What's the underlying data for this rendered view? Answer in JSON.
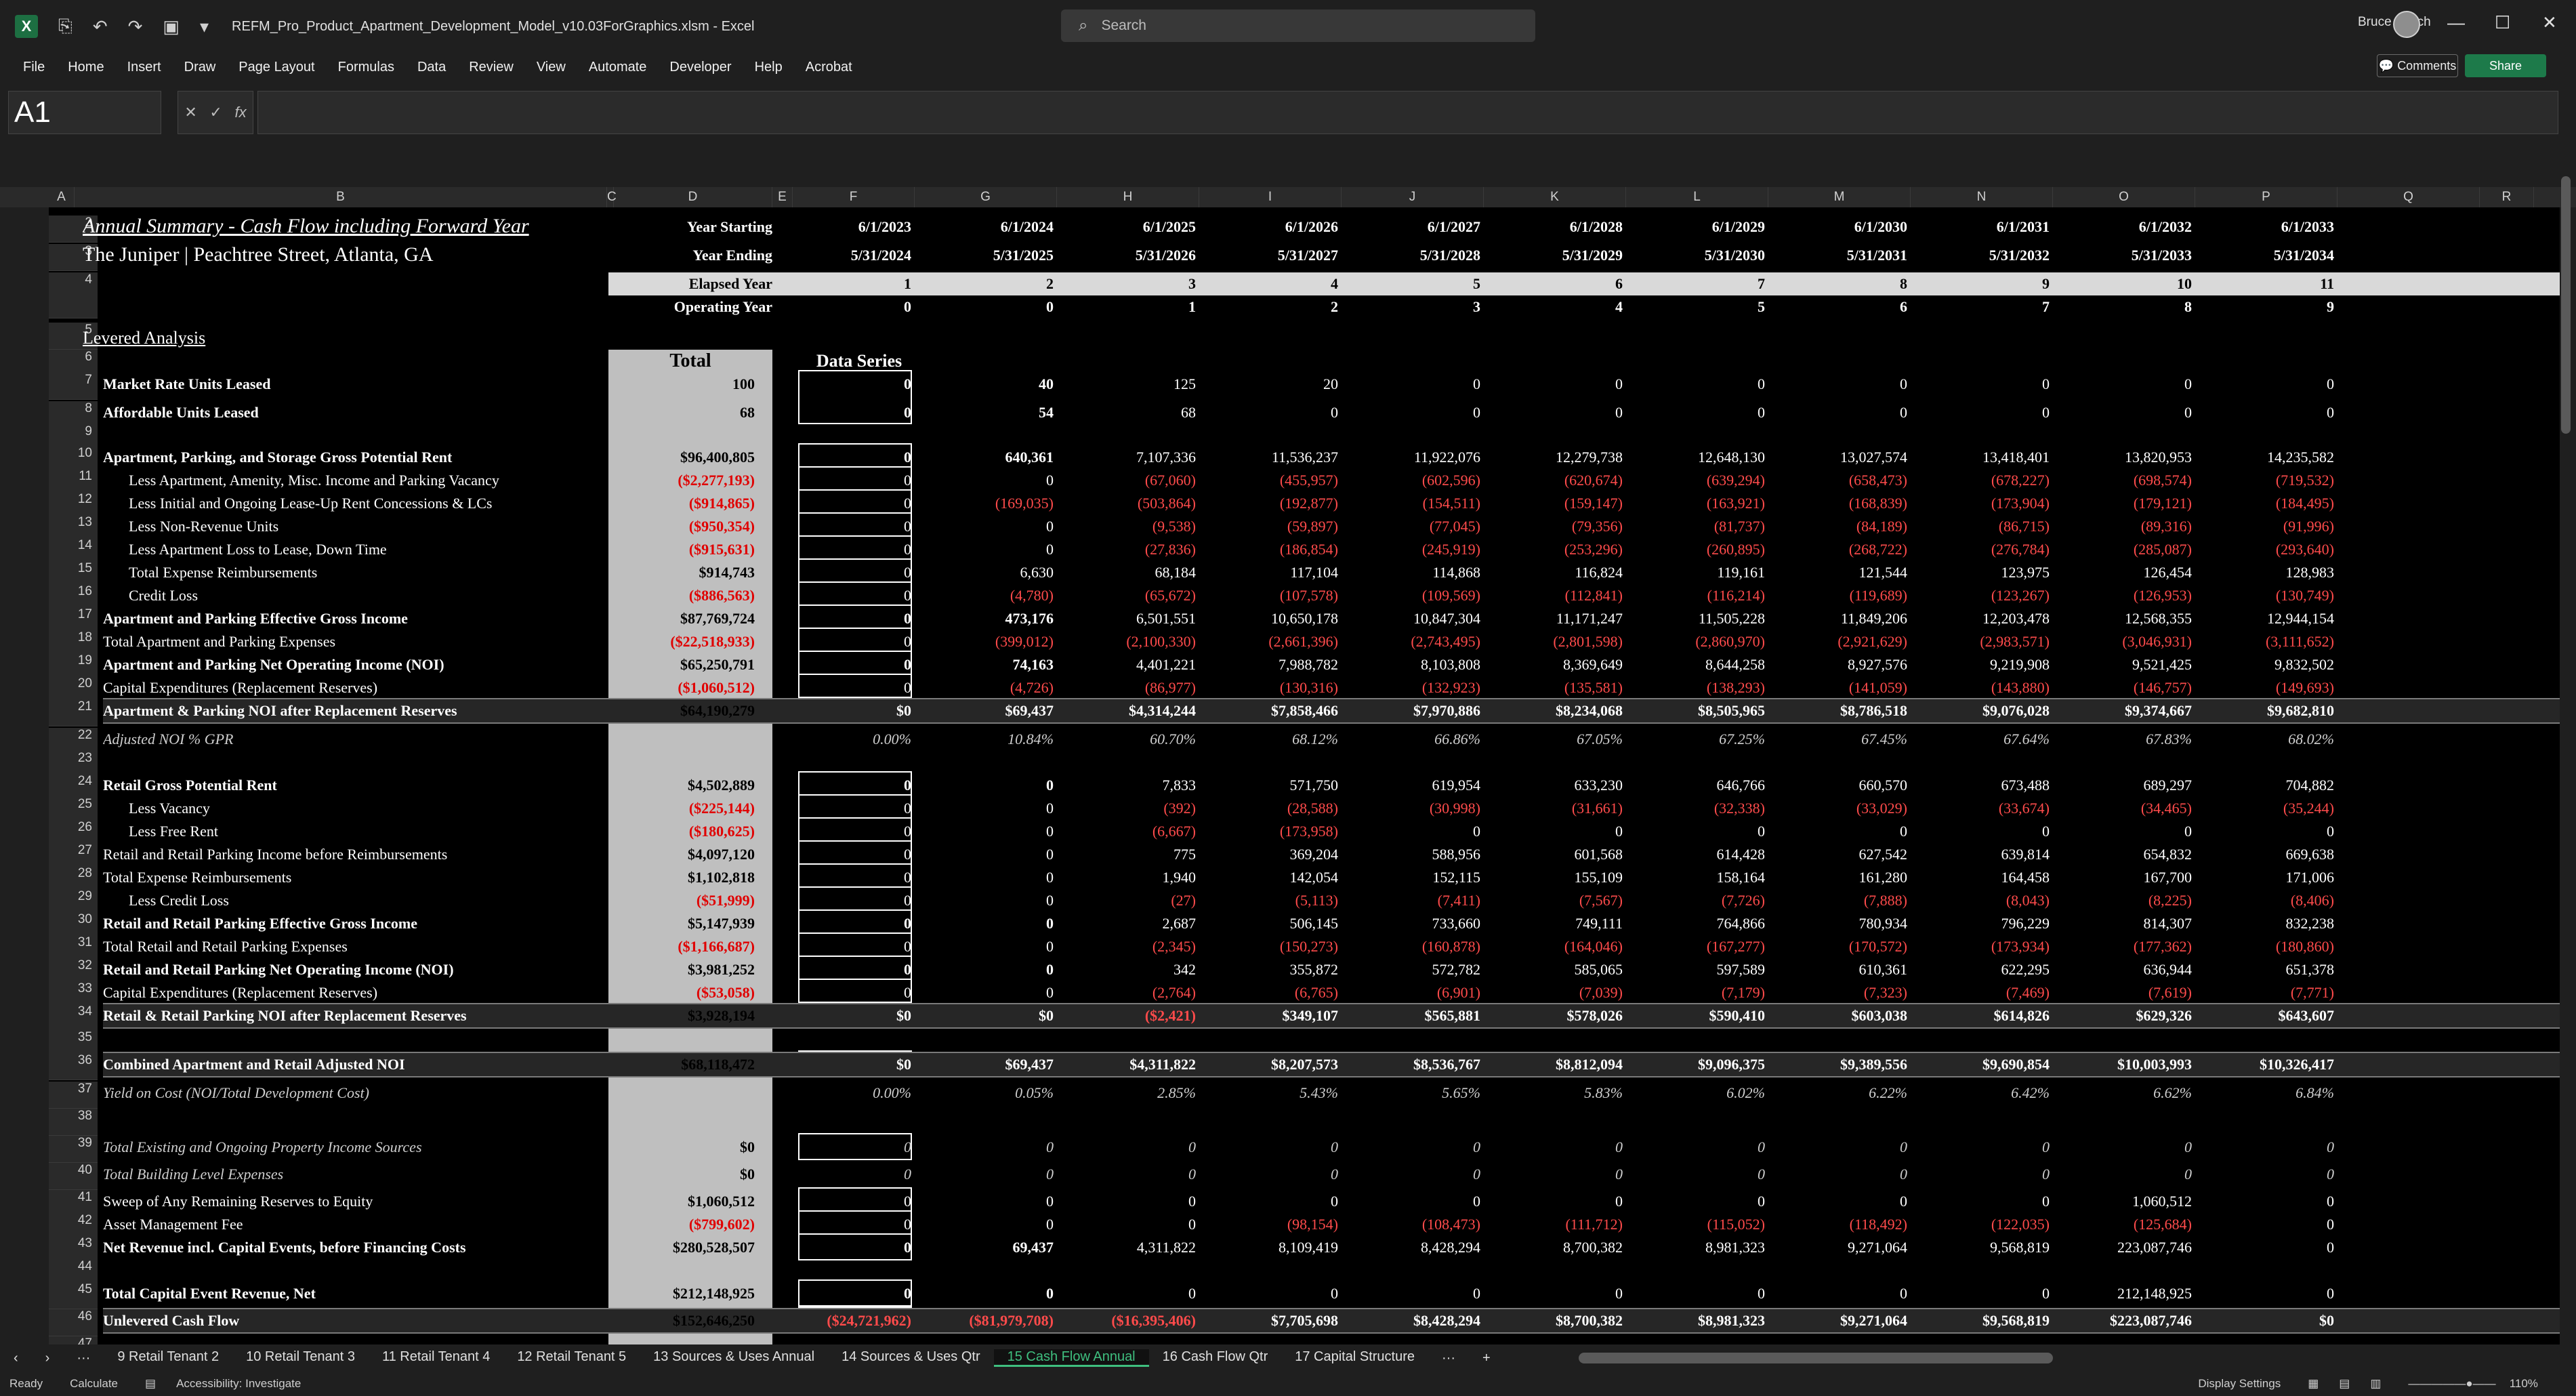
{
  "window": {
    "title": "REFM_Pro_Product_Apartment_Development_Model_v10.03ForGraphics.xlsm  -  Excel",
    "search_placeholder": "Search",
    "user": "Bruce Kirsch"
  },
  "menu": [
    "File",
    "Home",
    "Insert",
    "Draw",
    "Page Layout",
    "Formulas",
    "Data",
    "Review",
    "View",
    "Automate",
    "Developer",
    "Help",
    "Acrobat"
  ],
  "buttons": {
    "comments": "Comments",
    "share": "Share"
  },
  "formula": {
    "namebox": "A1",
    "fx": "fx"
  },
  "columns": [
    "A",
    "B",
    "C",
    "D",
    "E",
    "F",
    "G",
    "H",
    "I",
    "J",
    "K",
    "L",
    "M",
    "N",
    "O",
    "P",
    "Q",
    "R"
  ],
  "sheet": {
    "title": "Annual Summary - Cash Flow including Forward Year",
    "subtitle": "The Juniper  |  Peachtree Street, Atlanta, GA",
    "section": "Levered Analysis",
    "total_header": "Total",
    "series_header": "Data Series",
    "year_labels": [
      "Year Starting",
      "Year Ending",
      "Elapsed Year",
      "Operating Year"
    ],
    "year_starting": [
      "6/1/2023",
      "6/1/2024",
      "6/1/2025",
      "6/1/2026",
      "6/1/2027",
      "6/1/2028",
      "6/1/2029",
      "6/1/2030",
      "6/1/2031",
      "6/1/2032",
      "6/1/2033"
    ],
    "year_ending": [
      "5/31/2024",
      "5/31/2025",
      "5/31/2026",
      "5/31/2027",
      "5/31/2028",
      "5/31/2029",
      "5/31/2030",
      "5/31/2031",
      "5/31/2032",
      "5/31/2033",
      "5/31/2034"
    ],
    "elapsed": [
      "1",
      "2",
      "3",
      "4",
      "5",
      "6",
      "7",
      "8",
      "9",
      "10",
      "11"
    ],
    "operating": [
      "0",
      "0",
      "1",
      "2",
      "3",
      "4",
      "5",
      "6",
      "7",
      "8",
      "9"
    ],
    "rows": [
      {
        "r": "7",
        "label": "Market Rate Units Leased",
        "style": "b",
        "total": "100",
        "vals": [
          "0",
          "40",
          "125",
          "20",
          "0",
          "0",
          "0",
          "0",
          "0",
          "0",
          "0"
        ]
      },
      {
        "r": "8",
        "label": "Affordable Units Leased",
        "style": "b",
        "total": "68",
        "vals": [
          "0",
          "54",
          "68",
          "0",
          "0",
          "0",
          "0",
          "0",
          "0",
          "0",
          "0"
        ]
      },
      {
        "r": "10",
        "label": "Apartment, Parking, and Storage Gross Potential Rent",
        "style": "b",
        "total": "$96,400,805",
        "vals": [
          "0",
          "640,361",
          "7,107,336",
          "11,536,237",
          "11,922,076",
          "12,279,738",
          "12,648,130",
          "13,027,574",
          "13,418,401",
          "13,820,953",
          "14,235,582"
        ]
      },
      {
        "r": "11",
        "label": "Less Apartment, Amenity, Misc. Income and Parking Vacancy",
        "style": "ind",
        "total": "($2,277,193)",
        "vals": [
          "0",
          "0",
          "(67,060)",
          "(455,957)",
          "(602,596)",
          "(620,674)",
          "(639,294)",
          "(658,473)",
          "(678,227)",
          "(698,574)",
          "(719,532)"
        ]
      },
      {
        "r": "12",
        "label": "Less Initial and Ongoing Lease-Up Rent Concessions & LCs",
        "style": "ind",
        "total": "($914,865)",
        "vals": [
          "0",
          "(169,035)",
          "(503,864)",
          "(192,877)",
          "(154,511)",
          "(159,147)",
          "(163,921)",
          "(168,839)",
          "(173,904)",
          "(179,121)",
          "(184,495)"
        ]
      },
      {
        "r": "13",
        "label": "Less Non-Revenue Units",
        "style": "ind",
        "total": "($950,354)",
        "vals": [
          "0",
          "0",
          "(9,538)",
          "(59,897)",
          "(77,045)",
          "(79,356)",
          "(81,737)",
          "(84,189)",
          "(86,715)",
          "(89,316)",
          "(91,996)"
        ]
      },
      {
        "r": "14",
        "label": "Less Apartment Loss to Lease, Down Time",
        "style": "ind",
        "total": "($915,631)",
        "vals": [
          "0",
          "0",
          "(27,836)",
          "(186,854)",
          "(245,919)",
          "(253,296)",
          "(260,895)",
          "(268,722)",
          "(276,784)",
          "(285,087)",
          "(293,640)"
        ]
      },
      {
        "r": "15",
        "label": "Total Expense Reimbursements",
        "style": "ind",
        "total": "$914,743",
        "vals": [
          "0",
          "6,630",
          "68,184",
          "117,104",
          "114,868",
          "116,824",
          "119,161",
          "121,544",
          "123,975",
          "126,454",
          "128,983"
        ]
      },
      {
        "r": "16",
        "label": "Credit Loss",
        "style": "ind",
        "total": "($886,563)",
        "vals": [
          "0",
          "(4,780)",
          "(65,672)",
          "(107,578)",
          "(109,569)",
          "(112,841)",
          "(116,214)",
          "(119,689)",
          "(123,267)",
          "(126,953)",
          "(130,749)"
        ]
      },
      {
        "r": "17",
        "label": "Apartment and Parking Effective Gross Income",
        "style": "b",
        "total": "$87,769,724",
        "vals": [
          "0",
          "473,176",
          "6,501,551",
          "10,650,178",
          "10,847,304",
          "11,171,247",
          "11,505,228",
          "11,849,206",
          "12,203,478",
          "12,568,355",
          "12,944,154"
        ]
      },
      {
        "r": "18",
        "label": "Total Apartment and Parking Expenses",
        "style": "",
        "total": "($22,518,933)",
        "vals": [
          "0",
          "(399,012)",
          "(2,100,330)",
          "(2,661,396)",
          "(2,743,495)",
          "(2,801,598)",
          "(2,860,970)",
          "(2,921,629)",
          "(2,983,571)",
          "(3,046,931)",
          "(3,111,652)"
        ]
      },
      {
        "r": "19",
        "label": "Apartment and Parking Net Operating Income (NOI)",
        "style": "b",
        "total": "$65,250,791",
        "vals": [
          "0",
          "74,163",
          "4,401,221",
          "7,988,782",
          "8,103,808",
          "8,369,649",
          "8,644,258",
          "8,927,576",
          "9,219,908",
          "9,521,425",
          "9,832,502"
        ]
      },
      {
        "r": "20",
        "label": "Capital Expenditures (Replacement Reserves)",
        "style": "",
        "total": "($1,060,512)",
        "vals": [
          "0",
          "(4,726)",
          "(86,977)",
          "(130,316)",
          "(132,923)",
          "(135,581)",
          "(138,293)",
          "(141,059)",
          "(143,880)",
          "(146,757)",
          "(149,693)"
        ]
      },
      {
        "r": "21",
        "label": "Apartment & Parking NOI after Replacement Reserves",
        "style": "hl",
        "total": "$64,190,279",
        "vals": [
          "$0",
          "$69,437",
          "$4,314,244",
          "$7,858,466",
          "$7,970,886",
          "$8,234,068",
          "$8,505,965",
          "$8,786,518",
          "$9,076,028",
          "$9,374,667",
          "$9,682,810"
        ]
      },
      {
        "r": "22",
        "label": "Adjusted NOI % GPR",
        "style": "it",
        "total": "",
        "vals": [
          "0.00%",
          "10.84%",
          "60.70%",
          "68.12%",
          "66.86%",
          "67.05%",
          "67.25%",
          "67.45%",
          "67.64%",
          "67.83%",
          "68.02%"
        ]
      },
      {
        "r": "24",
        "label": "Retail Gross Potential Rent",
        "style": "b",
        "total": "$4,502,889",
        "vals": [
          "0",
          "0",
          "7,833",
          "571,750",
          "619,954",
          "633,230",
          "646,766",
          "660,570",
          "673,488",
          "689,297",
          "704,882"
        ]
      },
      {
        "r": "25",
        "label": "Less Vacancy",
        "style": "ind",
        "total": "($225,144)",
        "vals": [
          "0",
          "0",
          "(392)",
          "(28,588)",
          "(30,998)",
          "(31,661)",
          "(32,338)",
          "(33,029)",
          "(33,674)",
          "(34,465)",
          "(35,244)"
        ]
      },
      {
        "r": "26",
        "label": "Less Free Rent",
        "style": "ind",
        "total": "($180,625)",
        "vals": [
          "0",
          "0",
          "(6,667)",
          "(173,958)",
          "0",
          "0",
          "0",
          "0",
          "0",
          "0",
          "0"
        ]
      },
      {
        "r": "27",
        "label": "Retail and Retail Parking Income before Reimbursements",
        "style": "",
        "total": "$4,097,120",
        "vals": [
          "0",
          "0",
          "775",
          "369,204",
          "588,956",
          "601,568",
          "614,428",
          "627,542",
          "639,814",
          "654,832",
          "669,638"
        ]
      },
      {
        "r": "28",
        "label": "Total Expense Reimbursements",
        "style": "",
        "total": "$1,102,818",
        "vals": [
          "0",
          "0",
          "1,940",
          "142,054",
          "152,115",
          "155,109",
          "158,164",
          "161,280",
          "164,458",
          "167,700",
          "171,006"
        ]
      },
      {
        "r": "29",
        "label": "Less Credit Loss",
        "style": "ind",
        "total": "($51,999)",
        "vals": [
          "0",
          "0",
          "(27)",
          "(5,113)",
          "(7,411)",
          "(7,567)",
          "(7,726)",
          "(7,888)",
          "(8,043)",
          "(8,225)",
          "(8,406)"
        ]
      },
      {
        "r": "30",
        "label": "Retail and Retail Parking Effective Gross Income",
        "style": "b",
        "total": "$5,147,939",
        "vals": [
          "0",
          "0",
          "2,687",
          "506,145",
          "733,660",
          "749,111",
          "764,866",
          "780,934",
          "796,229",
          "814,307",
          "832,238"
        ]
      },
      {
        "r": "31",
        "label": "Total Retail and Retail Parking Expenses",
        "style": "",
        "total": "($1,166,687)",
        "vals": [
          "0",
          "0",
          "(2,345)",
          "(150,273)",
          "(160,878)",
          "(164,046)",
          "(167,277)",
          "(170,572)",
          "(173,934)",
          "(177,362)",
          "(180,860)"
        ]
      },
      {
        "r": "32",
        "label": "Retail and Retail Parking Net Operating Income (NOI)",
        "style": "b",
        "total": "$3,981,252",
        "vals": [
          "0",
          "0",
          "342",
          "355,872",
          "572,782",
          "585,065",
          "597,589",
          "610,361",
          "622,295",
          "636,944",
          "651,378"
        ]
      },
      {
        "r": "33",
        "label": "Capital Expenditures (Replacement Reserves)",
        "style": "",
        "total": "($53,058)",
        "vals": [
          "0",
          "0",
          "(2,764)",
          "(6,765)",
          "(6,901)",
          "(7,039)",
          "(7,179)",
          "(7,323)",
          "(7,469)",
          "(7,619)",
          "(7,771)"
        ]
      },
      {
        "r": "34",
        "label": "Retail & Retail Parking NOI after Replacement Reserves",
        "style": "hl",
        "total": "$3,928,194",
        "vals": [
          "$0",
          "$0",
          "($2,421)",
          "$349,107",
          "$565,881",
          "$578,026",
          "$590,410",
          "$603,038",
          "$614,826",
          "$629,326",
          "$643,607"
        ]
      },
      {
        "r": "36",
        "label": "Combined Apartment and Retail Adjusted NOI",
        "style": "hl",
        "total": "$68,118,472",
        "vals": [
          "$0",
          "$69,437",
          "$4,311,822",
          "$8,207,573",
          "$8,536,767",
          "$8,812,094",
          "$9,096,375",
          "$9,389,556",
          "$9,690,854",
          "$10,003,993",
          "$10,326,417"
        ]
      },
      {
        "r": "37",
        "label": "Yield on Cost (NOI/Total Development Cost)",
        "style": "it",
        "total": "",
        "vals": [
          "0.00%",
          "0.05%",
          "2.85%",
          "5.43%",
          "5.65%",
          "5.83%",
          "6.02%",
          "6.22%",
          "6.42%",
          "6.62%",
          "6.84%"
        ]
      },
      {
        "r": "39",
        "label": "Total Existing and Ongoing Property Income Sources",
        "style": "it",
        "total": "$0",
        "vals": [
          "0",
          "0",
          "0",
          "0",
          "0",
          "0",
          "0",
          "0",
          "0",
          "0",
          "0"
        ]
      },
      {
        "r": "40",
        "label": "Total Building Level Expenses",
        "style": "it",
        "total": "$0",
        "vals": [
          "0",
          "0",
          "0",
          "0",
          "0",
          "0",
          "0",
          "0",
          "0",
          "0",
          "0"
        ]
      },
      {
        "r": "41",
        "label": "Sweep of Any Remaining Reserves to Equity",
        "style": "",
        "total": "$1,060,512",
        "vals": [
          "0",
          "0",
          "0",
          "0",
          "0",
          "0",
          "0",
          "0",
          "0",
          "1,060,512",
          "0"
        ]
      },
      {
        "r": "42",
        "label": "Asset Management Fee",
        "style": "",
        "total": "($799,602)",
        "vals": [
          "0",
          "0",
          "0",
          "(98,154)",
          "(108,473)",
          "(111,712)",
          "(115,052)",
          "(118,492)",
          "(122,035)",
          "(125,684)",
          "0"
        ]
      },
      {
        "r": "43",
        "label": "Net Revenue incl. Capital Events, before Financing Costs",
        "style": "b",
        "total": "$280,528,507",
        "vals": [
          "0",
          "69,437",
          "4,311,822",
          "8,109,419",
          "8,428,294",
          "8,700,382",
          "8,981,323",
          "9,271,064",
          "9,568,819",
          "223,087,746",
          "0"
        ]
      },
      {
        "r": "45",
        "label": "Total Capital Event Revenue, Net",
        "style": "b",
        "total": "$212,148,925",
        "vals": [
          "0",
          "0",
          "0",
          "0",
          "0",
          "0",
          "0",
          "0",
          "0",
          "212,148,925",
          "0"
        ]
      },
      {
        "r": "46",
        "label": "Unlevered Cash Flow",
        "style": "hl",
        "total": "$152,646,250",
        "vals": [
          "($24,721,962)",
          "($81,979,708)",
          "($16,395,406)",
          "$7,705,698",
          "$8,428,294",
          "$8,700,382",
          "$8,981,323",
          "$9,271,064",
          "$9,568,819",
          "$223,087,746",
          "$0"
        ]
      }
    ]
  },
  "tabs": [
    "9 Retail Tenant 2",
    "10 Retail Tenant 3",
    "11 Retail Tenant 4",
    "12 Retail Tenant 5",
    "13 Sources & Uses Annual",
    "14 Sources & Uses Qtr",
    "15 Cash Flow Annual",
    "16 Cash Flow Qtr",
    "17 Capital Structure"
  ],
  "active_tab": "15 Cash Flow Annual",
  "status": {
    "ready": "Ready",
    "calculate": "Calculate",
    "accessibility": "Accessibility: Investigate",
    "display": "Display Settings",
    "zoom": "110%"
  }
}
